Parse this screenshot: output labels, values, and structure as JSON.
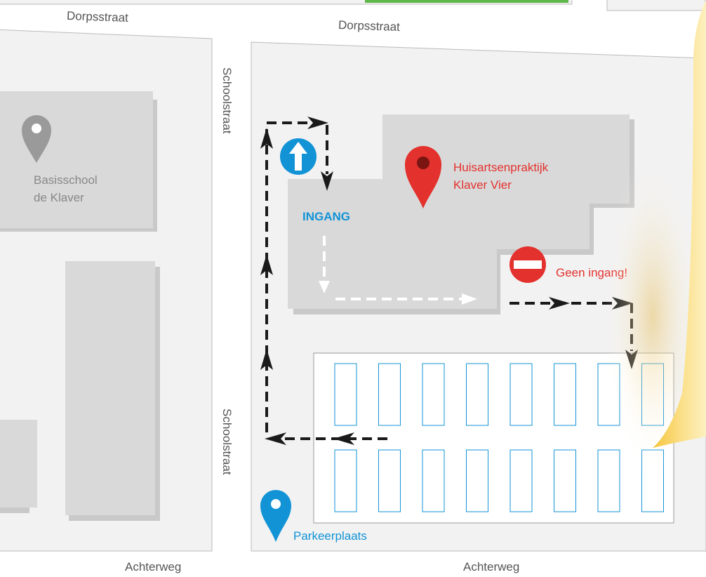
{
  "streets": {
    "top_left": "Dorpsstraat",
    "top_right": "Dorpsstraat",
    "left_upper": "Schoolstraat",
    "left_lower": "Schoolstraat",
    "bottom_left": "Achterweg",
    "bottom_right": "Achterweg"
  },
  "places": {
    "school": {
      "line1": "Basisschool",
      "line2": "de Klaver"
    },
    "practice": {
      "line1": "Huisartsenpraktijk",
      "line2": "Klaver Vier"
    },
    "parking": "Parkeerplaats"
  },
  "signs": {
    "entrance": "INGANG",
    "no_entry": "Geen ingang!"
  },
  "parking": {
    "spots_per_row": 8,
    "rows": 2
  },
  "colors": {
    "block": "#f2f2f2",
    "building": "#d9d9d9",
    "building_shadow": "#c7c7c7",
    "red": "#e3312d",
    "blue": "#1193d6",
    "route": "#1a1a1a",
    "note": "#f6c842"
  },
  "icons": {
    "school": "map-pin-icon",
    "practice": "map-pin-icon",
    "parking": "map-pin-icon",
    "one_way": "one-way-arrow-icon",
    "no_entry": "no-entry-icon"
  }
}
